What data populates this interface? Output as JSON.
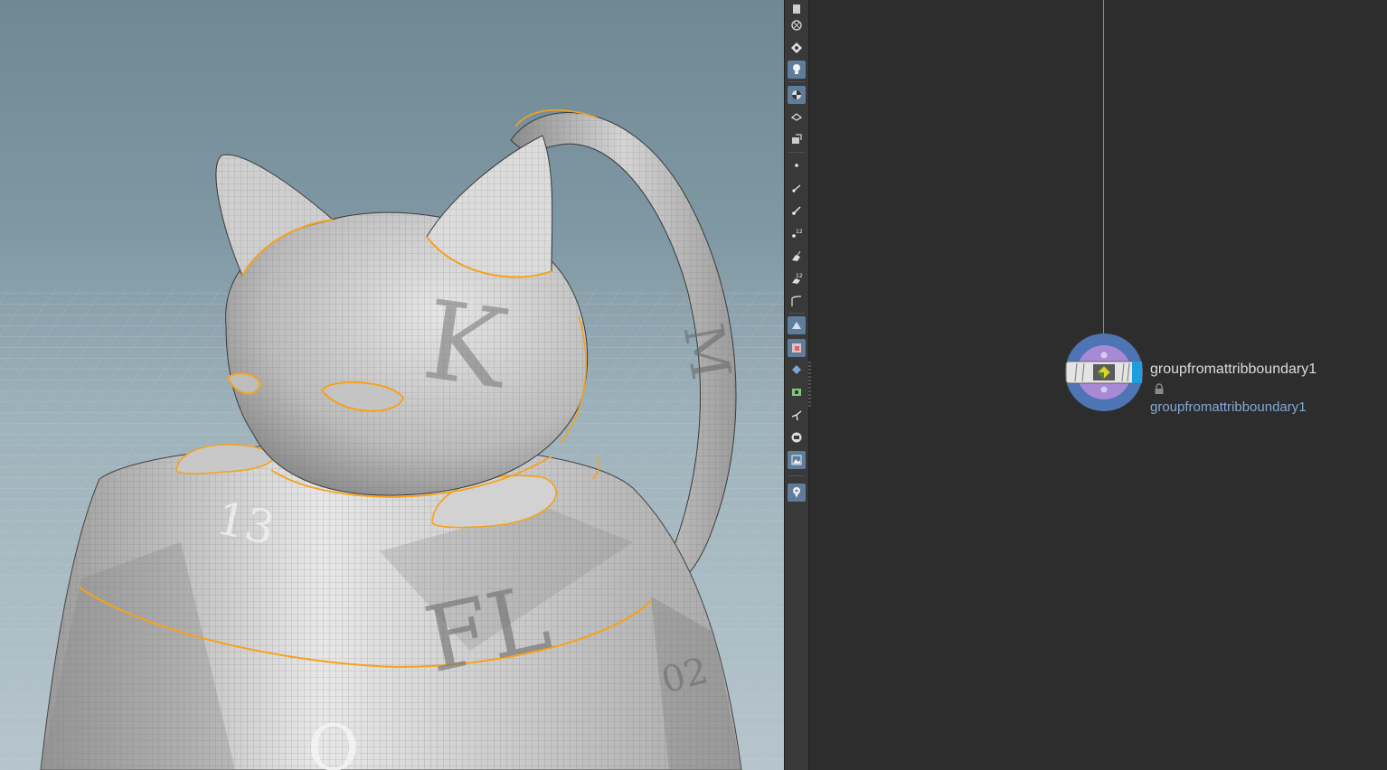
{
  "viewport": {
    "scene": "cat-on-dice-mesh",
    "selection_color": "#f5a21c",
    "background_color": "#7f98a3"
  },
  "toolbar": {
    "tools": [
      {
        "icon": "display-options-icon",
        "active": false
      },
      {
        "icon": "ghost-objects-icon",
        "active": false
      },
      {
        "icon": "shading-mode-icon",
        "active": false
      },
      {
        "icon": "light-bulb-icon",
        "active": true
      },
      {
        "icon": "texture-display-icon",
        "active": true
      },
      {
        "icon": "guide-display-icon",
        "active": false
      },
      {
        "icon": "material-display-icon",
        "active": false
      },
      {
        "icon": "point-display-icon",
        "active": false
      },
      {
        "icon": "point-normals-icon",
        "active": false
      },
      {
        "icon": "point-markers-icon",
        "active": false
      },
      {
        "icon": "point-numbers-icon",
        "active": false
      },
      {
        "icon": "primitive-normals-icon",
        "active": false
      },
      {
        "icon": "primitive-numbers-icon",
        "active": false
      },
      {
        "icon": "hull-display-icon",
        "active": false
      },
      {
        "icon": "uv-backface-icon",
        "active": true
      },
      {
        "icon": "uv-overlap-icon",
        "active": true
      },
      {
        "icon": "vertex-display-icon",
        "active": false
      },
      {
        "icon": "uv-boundary-icon",
        "active": false
      },
      {
        "icon": "handle-display-icon",
        "active": false
      },
      {
        "icon": "isolate-icon",
        "active": false
      },
      {
        "icon": "background-image-icon",
        "active": true
      },
      {
        "icon": "pin-viewport-icon",
        "active": true
      }
    ]
  },
  "network": {
    "node": {
      "name": "groupfromattribboundary1",
      "comment": "groupfromattribboundary1",
      "locked": true,
      "display_flag_color": "#1e9ee0",
      "ring_color": "#4e74b4",
      "inner_color": "#a889d6"
    },
    "wire_color": "#8a9a55"
  }
}
